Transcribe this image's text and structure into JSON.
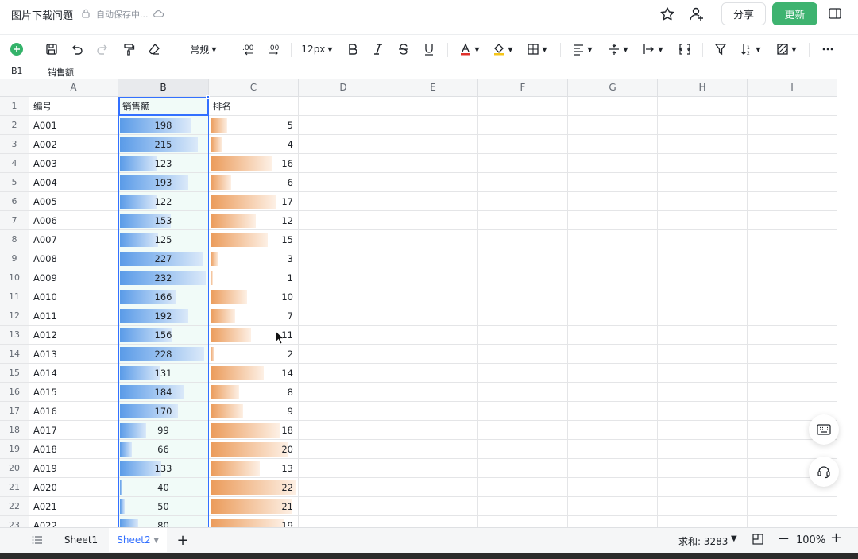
{
  "title_bar": {
    "doc_title": "图片下载问题",
    "save_status": "自动保存中...",
    "share_label": "分享",
    "update_label": "更新"
  },
  "toolbar": {
    "format_label": "常规",
    "font_size_label": "12px"
  },
  "formula_bar": {
    "cell_ref": "B1",
    "value": "销售额"
  },
  "columns": [
    "A",
    "B",
    "C",
    "D",
    "E",
    "F",
    "G",
    "H",
    "I"
  ],
  "selected_column": "B",
  "header_row": {
    "row": "1",
    "a": "编号",
    "b": "销售额",
    "c": "排名"
  },
  "rows": [
    {
      "row": "2",
      "a": "A001",
      "b": 198,
      "c": 5
    },
    {
      "row": "3",
      "a": "A002",
      "b": 215,
      "c": 4
    },
    {
      "row": "4",
      "a": "A003",
      "b": 123,
      "c": 16
    },
    {
      "row": "5",
      "a": "A004",
      "b": 193,
      "c": 6
    },
    {
      "row": "6",
      "a": "A005",
      "b": 122,
      "c": 17
    },
    {
      "row": "7",
      "a": "A006",
      "b": 153,
      "c": 12
    },
    {
      "row": "8",
      "a": "A007",
      "b": 125,
      "c": 15
    },
    {
      "row": "9",
      "a": "A008",
      "b": 227,
      "c": 3
    },
    {
      "row": "10",
      "a": "A009",
      "b": 232,
      "c": 1
    },
    {
      "row": "11",
      "a": "A010",
      "b": 166,
      "c": 10
    },
    {
      "row": "12",
      "a": "A011",
      "b": 192,
      "c": 7
    },
    {
      "row": "13",
      "a": "A012",
      "b": 156,
      "c": 11
    },
    {
      "row": "14",
      "a": "A013",
      "b": 228,
      "c": 2
    },
    {
      "row": "15",
      "a": "A014",
      "b": 131,
      "c": 14
    },
    {
      "row": "16",
      "a": "A015",
      "b": 184,
      "c": 8
    },
    {
      "row": "17",
      "a": "A016",
      "b": 170,
      "c": 9
    },
    {
      "row": "18",
      "a": "A017",
      "b": 99,
      "c": 18
    },
    {
      "row": "19",
      "a": "A018",
      "b": 66,
      "c": 20
    },
    {
      "row": "20",
      "a": "A019",
      "b": 133,
      "c": 13
    },
    {
      "row": "21",
      "a": "A020",
      "b": 40,
      "c": 22
    },
    {
      "row": "22",
      "a": "A021",
      "b": 50,
      "c": 21
    },
    {
      "row": "23",
      "a": "A022",
      "b": 80,
      "c": 19
    }
  ],
  "data_bars": {
    "b_min": 40,
    "b_max": 232,
    "b_color": "#5a9be8",
    "c_min": 1,
    "c_max": 22,
    "c_color": "#eb9b5a"
  },
  "sheets": [
    "Sheet1",
    "Sheet2"
  ],
  "active_sheet": "Sheet2",
  "status": {
    "sum_label": "求和: 3283",
    "zoom": "100%"
  },
  "colors": {
    "accent": "#3370ff",
    "update_button": "#3eb370",
    "selected_column_fill": "#f1fbf8"
  }
}
